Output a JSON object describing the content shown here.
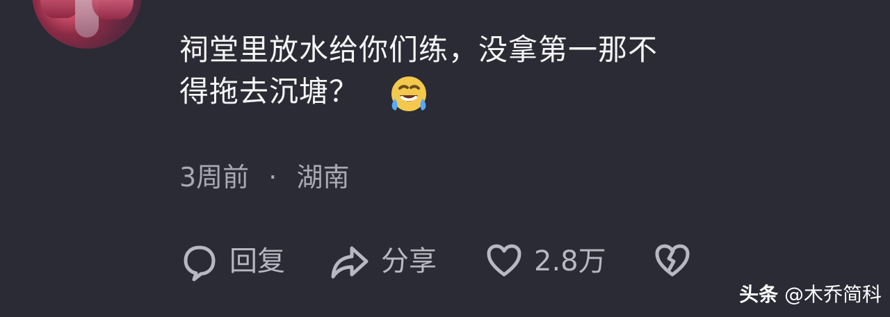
{
  "comment": {
    "line1": "祠堂里放水给你们练，没拿第一那不",
    "line2": "得拖去沉塘？",
    "emoji": "rolling-on-the-floor-laughing-icon"
  },
  "meta": {
    "time": "3周前",
    "separator": "·",
    "location": "湖南"
  },
  "actions": {
    "reply_label": "回复",
    "share_label": "分享",
    "likes_count": "2.8万"
  },
  "watermark": {
    "brand": "头条",
    "account": "@木乔简科"
  },
  "colors": {
    "background": "#2a2b34",
    "text_primary": "#f5f5f7",
    "text_secondary": "#a8a9b2",
    "icon_gray": "#b7b8c1"
  }
}
